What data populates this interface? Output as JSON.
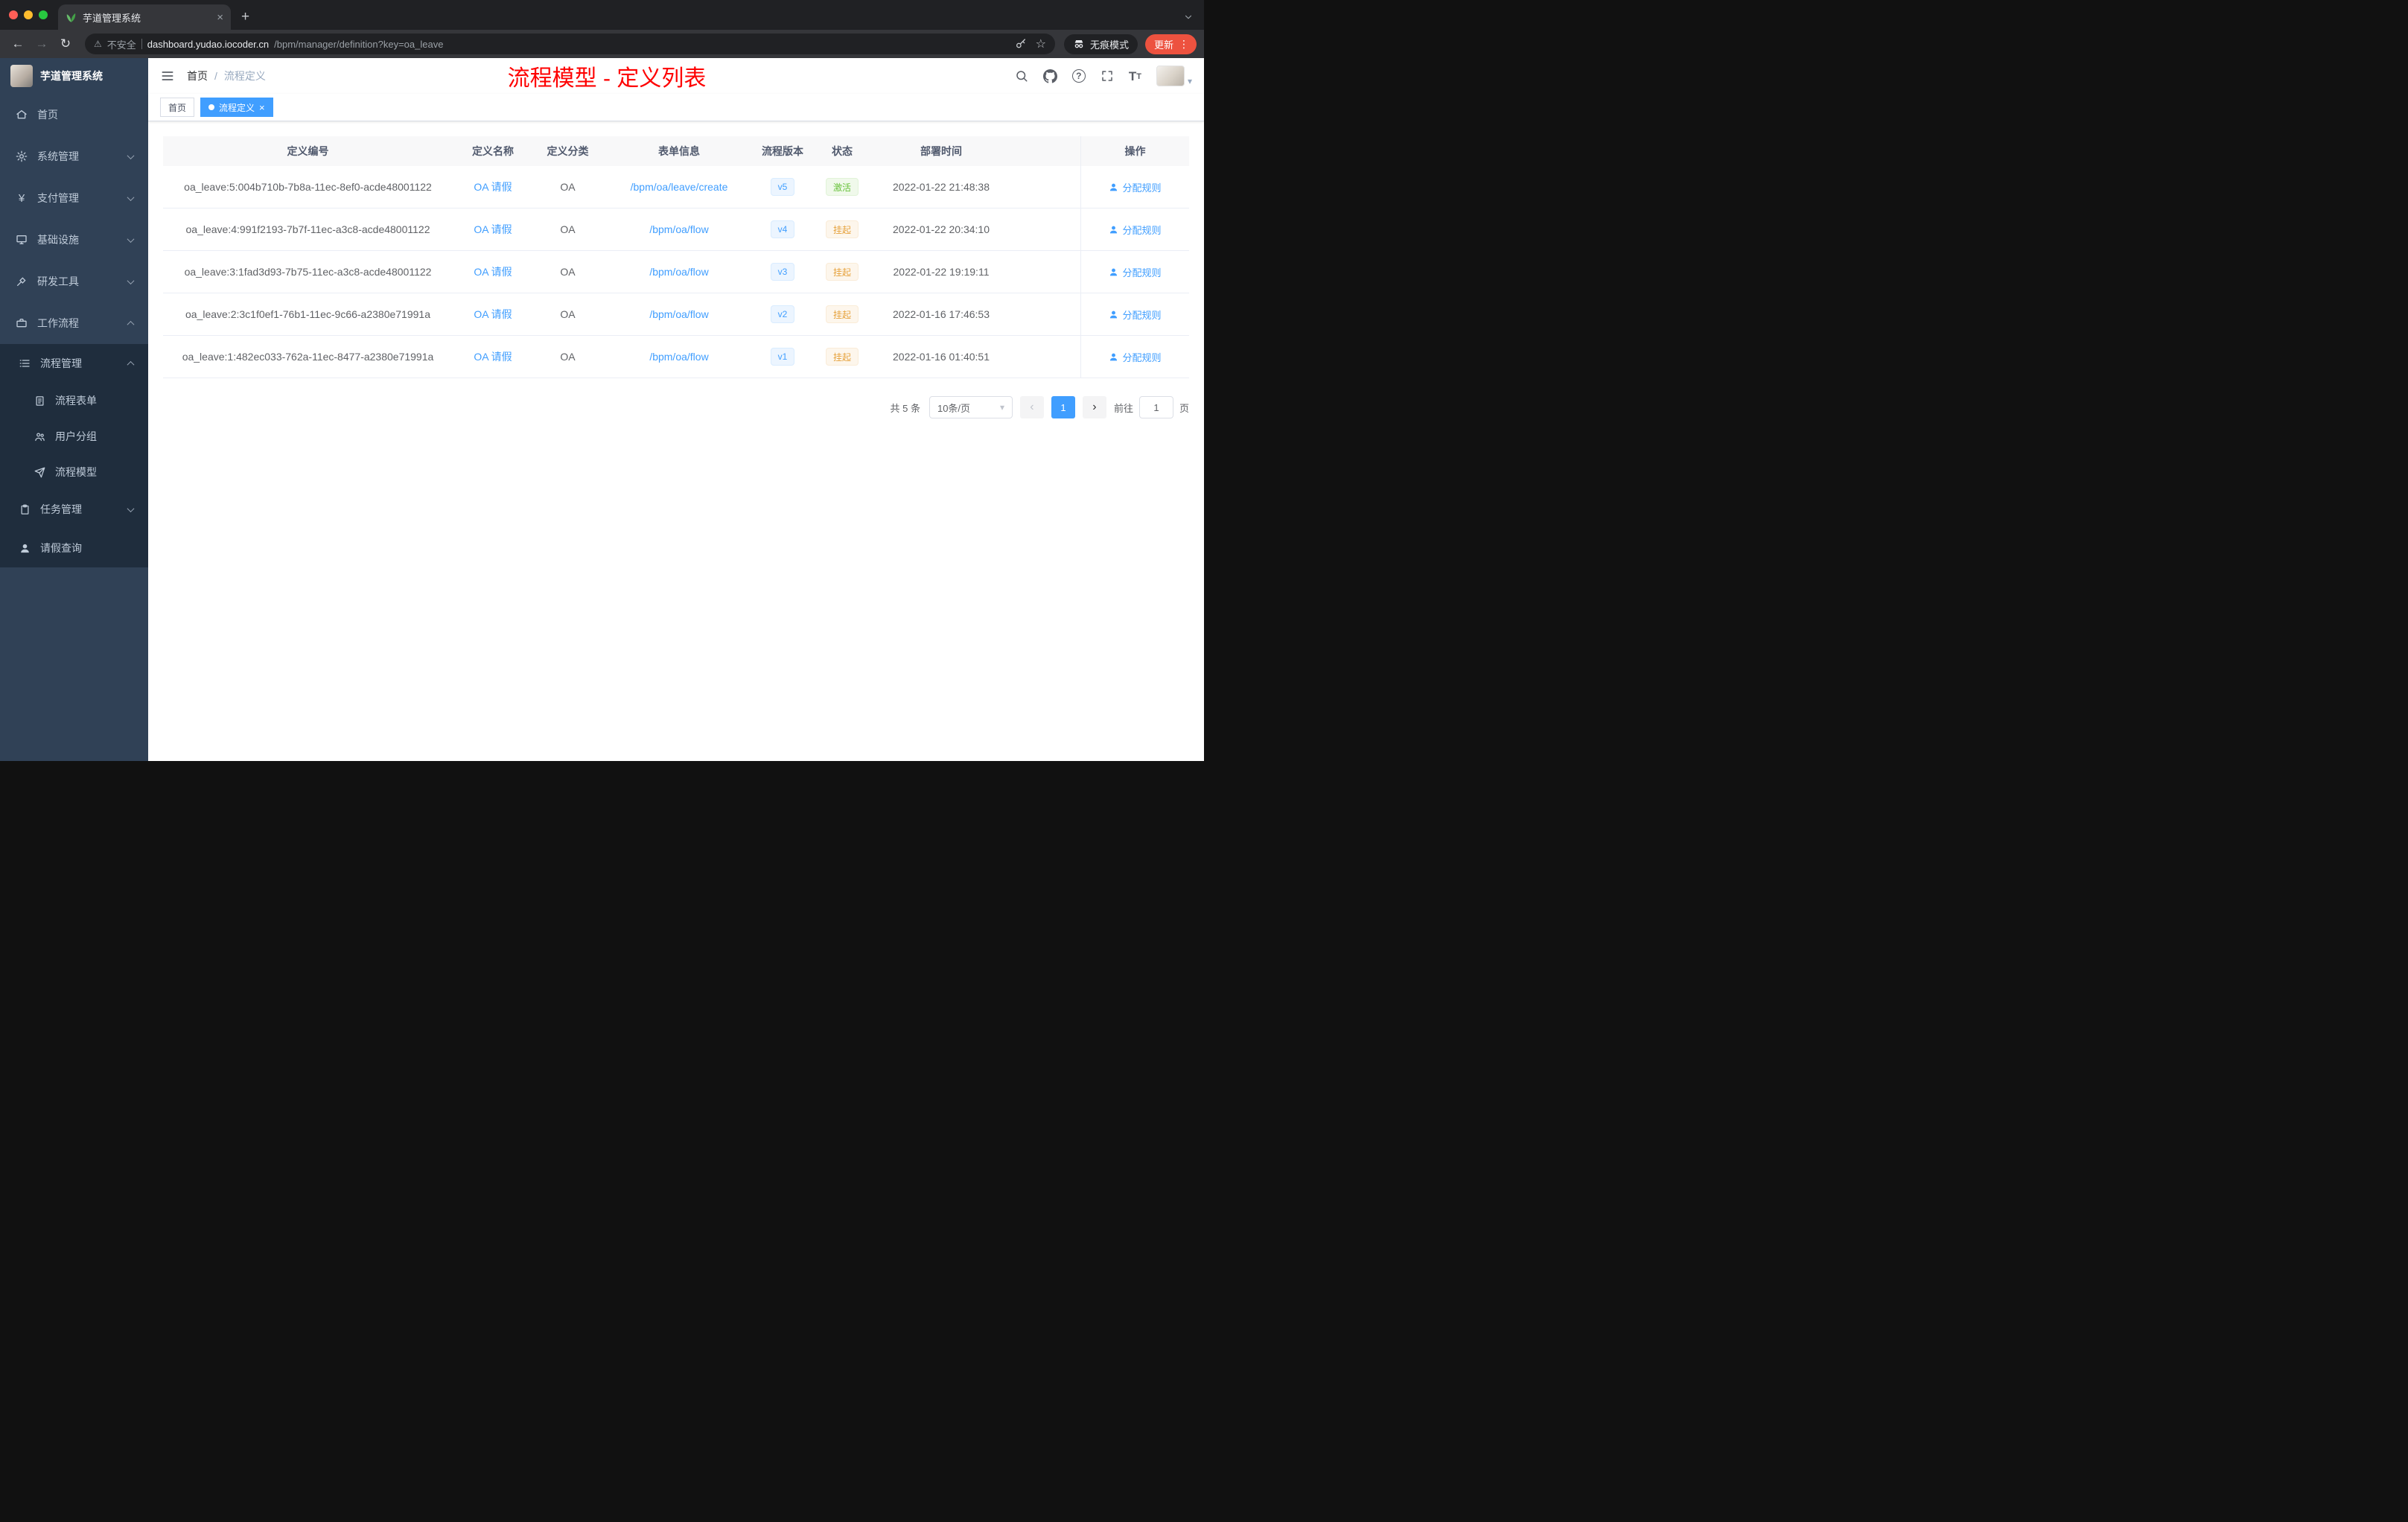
{
  "colors": {
    "accent": "#409eff",
    "annotation_red": "#fe0000",
    "success_green": "#67c23a",
    "warning_yellow": "#e6a23c",
    "sidebar_bg": "#304156",
    "submenu_bg": "#1f2d3d"
  },
  "browser": {
    "tab_title": "芋道管理系统",
    "security_label": "不安全",
    "url_host": "dashboard.yudao.iocoder.cn",
    "url_path": "/bpm/manager/definition?key=oa_leave",
    "incognito_label": "无痕模式",
    "update_label": "更新"
  },
  "icons": {
    "close": "×",
    "plus": "+",
    "dots": "⋮",
    "star": "☆",
    "warning": "⚠",
    "back": "←",
    "forward": "→",
    "reload": "↻",
    "caret_down": "▾",
    "chevron_left": "‹",
    "chevron_right": "›",
    "yen": "¥",
    "question": "?",
    "letter_t_large": "T",
    "letter_t_small": "T"
  },
  "sidebar": {
    "app_title": "芋道管理系统",
    "menu": [
      {
        "label": "首页"
      },
      {
        "label": "系统管理"
      },
      {
        "label": "支付管理"
      },
      {
        "label": "基础设施"
      },
      {
        "label": "研发工具"
      },
      {
        "label": "工作流程",
        "expanded": true,
        "children": [
          {
            "label": "流程管理",
            "expanded": true,
            "children": [
              {
                "label": "流程表单"
              },
              {
                "label": "用户分组"
              },
              {
                "label": "流程模型"
              }
            ]
          },
          {
            "label": "任务管理"
          },
          {
            "label": "请假查询"
          }
        ]
      }
    ]
  },
  "header": {
    "breadcrumb_home": "首页",
    "breadcrumb_separator": "/",
    "breadcrumb_current": "流程定义",
    "annotation": "流程模型 - 定义列表"
  },
  "tags_view": {
    "tags": [
      {
        "label": "首页",
        "active": false
      },
      {
        "label": "流程定义",
        "active": true
      }
    ]
  },
  "table": {
    "columns": [
      "定义编号",
      "定义名称",
      "定义分类",
      "表单信息",
      "流程版本",
      "状态",
      "部署时间",
      "操作"
    ],
    "rows": [
      {
        "id": "oa_leave:5:004b710b-7b8a-11ec-8ef0-acde48001122",
        "name": "OA 请假",
        "category": "OA",
        "form": "/bpm/oa/leave/create",
        "version": "v5",
        "status": "激活",
        "status_type": "success",
        "deployed_at": "2022-01-22 21:48:38",
        "action": "分配规则"
      },
      {
        "id": "oa_leave:4:991f2193-7b7f-11ec-a3c8-acde48001122",
        "name": "OA 请假",
        "category": "OA",
        "form": "/bpm/oa/flow",
        "version": "v4",
        "status": "挂起",
        "status_type": "warning",
        "deployed_at": "2022-01-22 20:34:10",
        "action": "分配规则"
      },
      {
        "id": "oa_leave:3:1fad3d93-7b75-11ec-a3c8-acde48001122",
        "name": "OA 请假",
        "category": "OA",
        "form": "/bpm/oa/flow",
        "version": "v3",
        "status": "挂起",
        "status_type": "warning",
        "deployed_at": "2022-01-22 19:19:11",
        "action": "分配规则"
      },
      {
        "id": "oa_leave:2:3c1f0ef1-76b1-11ec-9c66-a2380e71991a",
        "name": "OA 请假",
        "category": "OA",
        "form": "/bpm/oa/flow",
        "version": "v2",
        "status": "挂起",
        "status_type": "warning",
        "deployed_at": "2022-01-16 17:46:53",
        "action": "分配规则"
      },
      {
        "id": "oa_leave:1:482ec033-762a-11ec-8477-a2380e71991a",
        "name": "OA 请假",
        "category": "OA",
        "form": "/bpm/oa/flow",
        "version": "v1",
        "status": "挂起",
        "status_type": "warning",
        "deployed_at": "2022-01-16 01:40:51",
        "action": "分配规则"
      }
    ]
  },
  "pagination": {
    "total": "共 5 条",
    "page_size": "10条/页",
    "current_page": "1",
    "goto_label": "前往",
    "goto_value": "1",
    "page_unit": "页"
  }
}
